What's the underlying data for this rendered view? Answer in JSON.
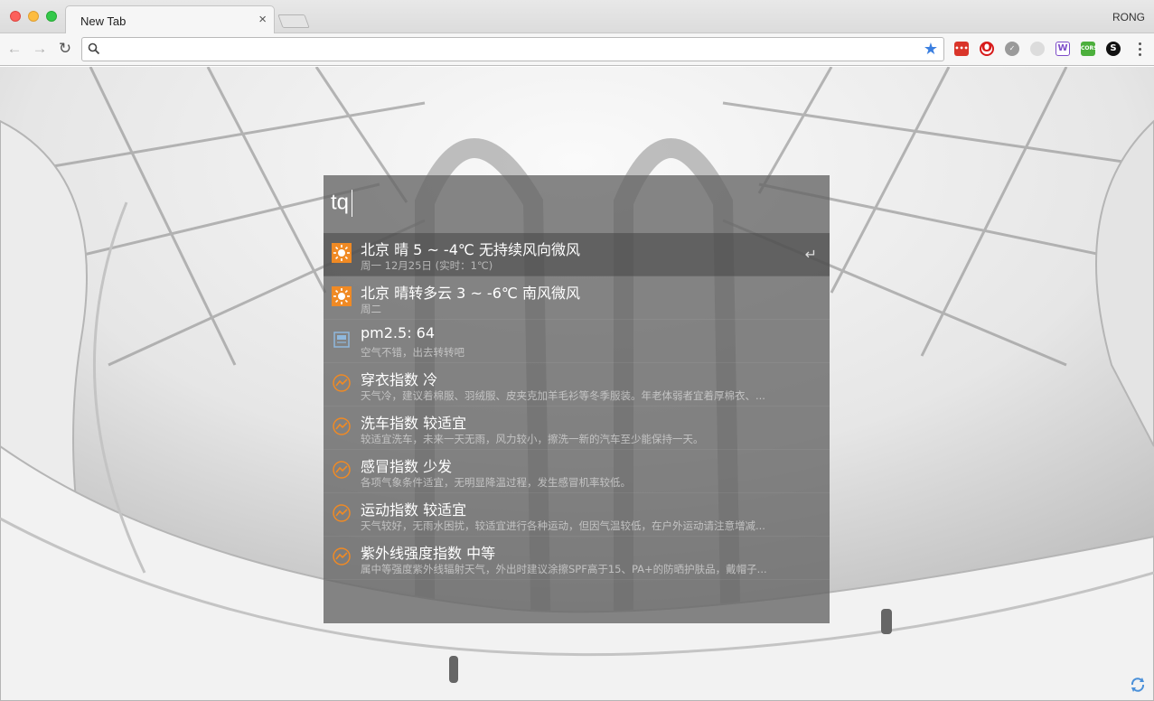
{
  "window": {
    "tab_title": "New Tab",
    "tab_close": "×",
    "profile_name": "RONG"
  },
  "toolbar": {
    "back": "←",
    "forward": "→",
    "reload": "↻",
    "address_value": "",
    "address_placeholder": "",
    "star": "★",
    "extensions": [
      {
        "name": "ext-lastpass-icon",
        "glyph": "•••",
        "color": "#d9352a"
      },
      {
        "name": "ext-opera-icon",
        "glyph": "O",
        "color": "#d71a1a"
      },
      {
        "name": "ext-gray-check-icon",
        "glyph": "✓",
        "color": "#9a9a9a"
      },
      {
        "name": "ext-light-swirl-icon",
        "glyph": "",
        "color": "#dcdcdc"
      },
      {
        "name": "ext-w-icon",
        "glyph": "W",
        "color": "#7d4cc9"
      },
      {
        "name": "ext-cors-icon",
        "glyph": "CORS",
        "color": "#4caf3c"
      },
      {
        "name": "ext-s-icon",
        "glyph": "S",
        "color": "#111111"
      }
    ]
  },
  "launcher": {
    "query": "tq",
    "enter_glyph": "↵",
    "results": [
      {
        "icon": "sun-icon",
        "title": "北京 晴 5 ~ -4℃ 无持续风向微风",
        "subtitle": "周一 12月25日 (实时：1℃)",
        "selected": true
      },
      {
        "icon": "sun-icon",
        "title": "北京 晴转多云 3 ~ -6℃ 南风微风",
        "subtitle": "周二",
        "selected": false
      },
      {
        "icon": "pm-chart-icon",
        "title": "pm2.5: 64",
        "subtitle": "空气不错，出去转转吧",
        "selected": false
      },
      {
        "icon": "trend-icon",
        "title": "穿衣指数 冷",
        "subtitle": "天气冷，建议着棉服、羽绒服、皮夹克加羊毛衫等冬季服装。年老体弱者宜着厚棉衣、...",
        "selected": false
      },
      {
        "icon": "trend-icon",
        "title": "洗车指数 较适宜",
        "subtitle": "较适宜洗车，未来一天无雨，风力较小，擦洗一新的汽车至少能保持一天。",
        "selected": false
      },
      {
        "icon": "trend-icon",
        "title": "感冒指数 少发",
        "subtitle": "各项气象条件适宜，无明显降温过程，发生感冒机率较低。",
        "selected": false
      },
      {
        "icon": "trend-icon",
        "title": "运动指数 较适宜",
        "subtitle": "天气较好，无雨水困扰，较适宜进行各种运动，但因气温较低，在户外运动请注意增减...",
        "selected": false
      },
      {
        "icon": "trend-icon",
        "title": "紫外线强度指数 中等",
        "subtitle": "属中等强度紫外线辐射天气，外出时建议涂擦SPF高于15、PA+的防晒护肤品，戴帽子...",
        "selected": false
      }
    ]
  },
  "colors": {
    "accent_orange": "#f08a24",
    "star_blue": "#3b7fe0"
  }
}
